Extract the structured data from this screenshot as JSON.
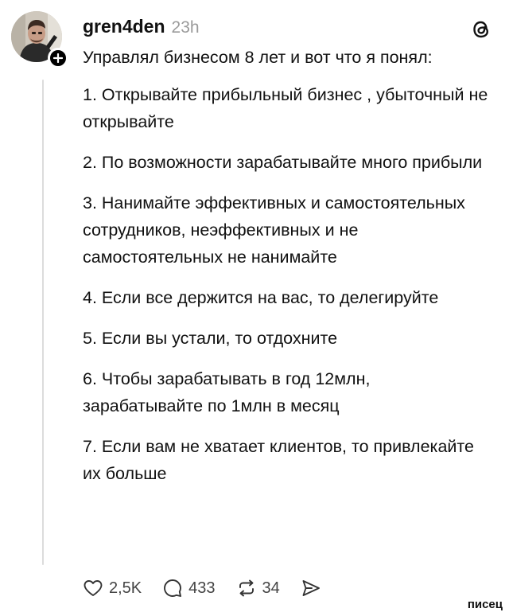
{
  "post": {
    "username": "gren4den",
    "timestamp": "23h",
    "intro": "Управлял бизнесом 8 лет и вот что я понял:",
    "points": [
      "1. Открывайте прибыльный бизнес , убыточный не открывайте",
      "2. По возможности зарабатывайте много прибыли",
      "3. Нанимайте эффективных и самостоятельных сотрудников, неэффективных и не самостоятельных не нанимайте",
      "4. Если все держится на вас, то делегируйте",
      "5. Если вы устали, то отдохните",
      "6. Чтобы зарабатывать в год 12млн, зарабатывайте по 1млн в месяц",
      "7. Если вам не хватает клиентов, то привлекайте их больше"
    ]
  },
  "actions": {
    "likes": "2,5K",
    "replies": "433",
    "reposts": "34"
  },
  "icons": {
    "like": "heart-icon",
    "reply": "comment-bubble-icon",
    "repost": "repost-icon",
    "share": "send-icon",
    "app": "threads-logo-icon",
    "follow": "plus-icon"
  },
  "watermark": "писец"
}
